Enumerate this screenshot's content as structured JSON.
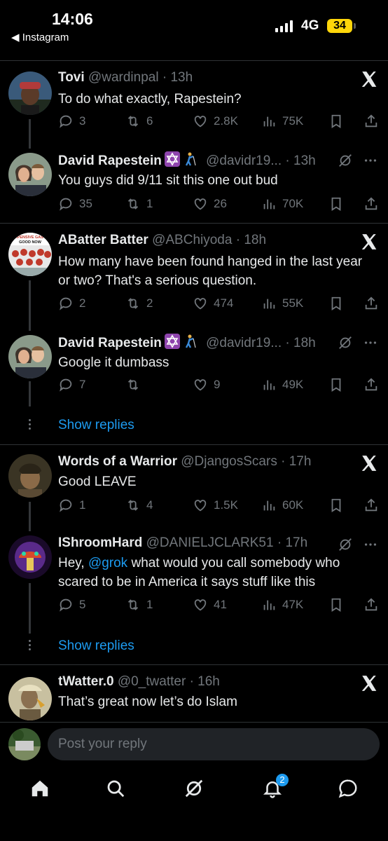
{
  "status_bar": {
    "time": "14:06",
    "back_app": "◀ Instagram",
    "network": "4G",
    "battery": "34"
  },
  "tweets": [
    {
      "name": "Tovi",
      "handle": "@wardinpal",
      "time": "· 13h",
      "text": "To do what exactly, Rapestein?",
      "replies": "3",
      "reposts": "6",
      "likes": "2.8K",
      "views": "75K"
    },
    {
      "name": "David Rapestein",
      "emoji": [
        "star-of-david-icon",
        "golfer-icon"
      ],
      "handle": "@davidr19...",
      "time": "· 13h",
      "text": "You guys did 9/11 sit this one out bud",
      "replies": "35",
      "reposts": "1",
      "likes": "26",
      "views": "70K"
    },
    {
      "name": "ABatter Batter",
      "handle": "@ABChiyoda",
      "time": "· 18h",
      "text": "How many have been found hanged in the last year or two? That's a serious question.",
      "replies": "2",
      "reposts": "2",
      "likes": "474",
      "views": "55K",
      "avatar_text": "EXPENSIVE GAS IS GOOD NOW"
    },
    {
      "name": "David Rapestein",
      "emoji": [
        "star-of-david-icon",
        "golfer-icon"
      ],
      "handle": "@davidr19...",
      "time": "· 18h",
      "text": "Google it dumbass",
      "replies": "7",
      "reposts": "",
      "likes": "9",
      "views": "49K"
    },
    {
      "name": "Words of a Warrior",
      "handle": "@DjangosScars",
      "time": "· 17h",
      "text": "Good LEAVE",
      "replies": "1",
      "reposts": "4",
      "likes": "1.5K",
      "views": "60K"
    },
    {
      "name": "IShroomHard",
      "handle": "@DANIELJCLARK51",
      "time": "· 17h",
      "text_prefix": "Hey, ",
      "mention": "@grok",
      "text_suffix": " what would you call somebody who scared to be in America it says stuff like this",
      "replies": "5",
      "reposts": "1",
      "likes": "41",
      "views": "47K"
    },
    {
      "name": "tWatter.0",
      "handle": "@0_twatter",
      "time": "· 16h",
      "text": "That’s great now let’s do Islam"
    }
  ],
  "show_replies_label": "Show replies",
  "reply_bar": {
    "placeholder": "Post your reply"
  },
  "nav": {
    "notifications_badge": "2"
  },
  "colors": {
    "accent": "#1d9bf0",
    "muted": "#71767b",
    "background": "#000000",
    "battery": "#ffd60a"
  }
}
